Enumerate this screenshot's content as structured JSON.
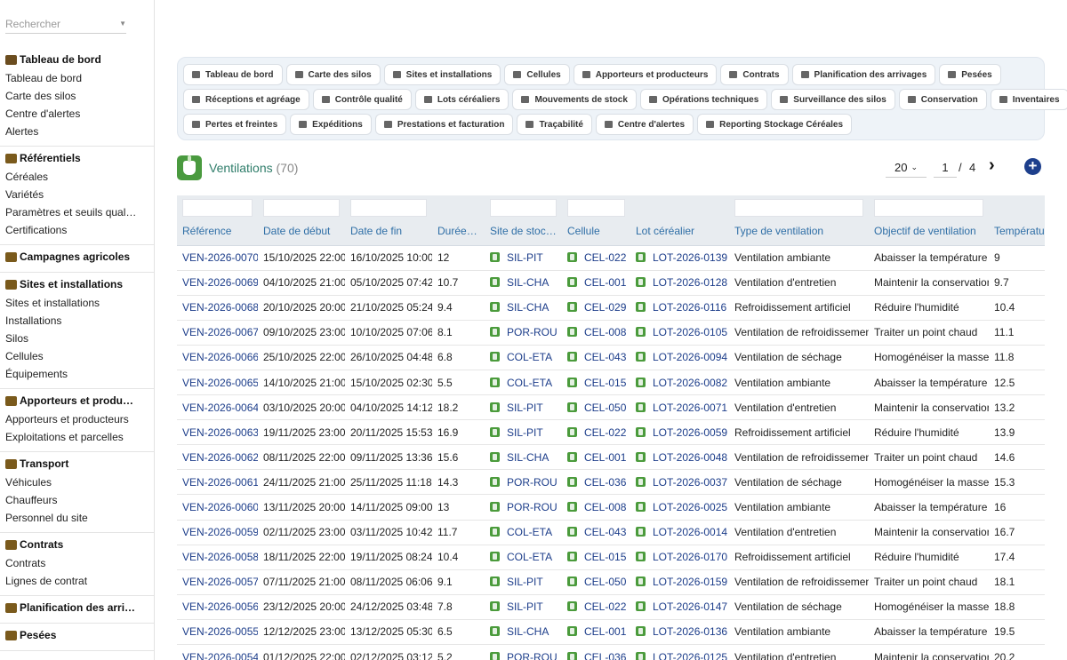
{
  "search": {
    "placeholder": "Rechercher"
  },
  "sidebar": {
    "sections": [
      {
        "title": "Tableau de bord",
        "icon": "dashboard-icon",
        "icon_color": "#6b4d1f",
        "items": [
          "Tableau de bord",
          "Carte des silos",
          "Centre d'alertes",
          "Alertes"
        ]
      },
      {
        "title": "Référentiels",
        "icon": "sprout-icon",
        "icon_color": "#7a5a1c",
        "items": [
          "Céréales",
          "Variétés",
          "Paramètres et seuils qual…",
          "Certifications"
        ]
      },
      {
        "title": "Campagnes agricoles",
        "icon": "calendar-icon",
        "icon_color": "#7a5a1c",
        "items": []
      },
      {
        "title": "Sites et installations",
        "icon": "warehouse-icon",
        "icon_color": "#7a5a1c",
        "items": [
          "Sites et installations",
          "Installations",
          "Silos",
          "Cellules",
          "Équipements"
        ]
      },
      {
        "title": "Apporteurs et produ…",
        "icon": "users-icon",
        "icon_color": "#7a5a1c",
        "items": [
          "Apporteurs et producteurs",
          "Exploitations et parcelles"
        ]
      },
      {
        "title": "Transport",
        "icon": "truck-icon",
        "icon_color": "#7a5a1c",
        "items": [
          "Véhicules",
          "Chauffeurs",
          "Personnel du site"
        ]
      },
      {
        "title": "Contrats",
        "icon": "contract-icon",
        "icon_color": "#7a5a1c",
        "items": [
          "Contrats",
          "Lignes de contrat"
        ]
      },
      {
        "title": "Planification des arri…",
        "icon": "truck-loading-icon",
        "icon_color": "#7a5a1c",
        "items": []
      },
      {
        "title": "Pesées",
        "icon": "scale-icon",
        "icon_color": "#7a5a1c",
        "items": []
      }
    ]
  },
  "menu": {
    "rows": [
      [
        {
          "label": "Tableau de bord",
          "icon": "dashboard-icon"
        },
        {
          "label": "Carte des silos",
          "icon": "grid-icon"
        },
        {
          "label": "Sites et installations",
          "icon": "warehouse-icon"
        },
        {
          "label": "Cellules",
          "icon": "grid-icon"
        },
        {
          "label": "Apporteurs et producteurs",
          "icon": "users-icon"
        },
        {
          "label": "Contrats",
          "icon": "contract-icon"
        },
        {
          "label": "Planification des arrivages",
          "icon": "truck-loading-icon"
        },
        {
          "label": "Pesées",
          "icon": "scale-icon"
        }
      ],
      [
        {
          "label": "Réceptions et agréage",
          "icon": "clipboard-icon"
        },
        {
          "label": "Contrôle qualité",
          "icon": "flask-icon"
        },
        {
          "label": "Lots céréaliers",
          "icon": "box-icon"
        },
        {
          "label": "Mouvements de stock",
          "icon": "exchange-icon"
        },
        {
          "label": "Opérations techniques",
          "icon": "tools-icon"
        },
        {
          "label": "Surveillance des silos",
          "icon": "thermometer-icon"
        },
        {
          "label": "Conservation",
          "icon": "shield-icon"
        },
        {
          "label": "Inventaires",
          "icon": "list-icon"
        }
      ],
      [
        {
          "label": "Pertes et freintes",
          "icon": "arrow-down-icon"
        },
        {
          "label": "Expéditions",
          "icon": "truck-icon"
        },
        {
          "label": "Prestations et facturation",
          "icon": "invoice-icon"
        },
        {
          "label": "Traçabilité",
          "icon": "network-icon"
        },
        {
          "label": "Centre d'alertes",
          "icon": "bell-icon"
        },
        {
          "label": "Reporting Stockage Céréales",
          "icon": "chart-pie-icon"
        }
      ]
    ]
  },
  "page": {
    "title": "Ventilations",
    "count": "(70)",
    "per_page": "20",
    "current_page": "1",
    "separator": "/",
    "total_pages": "4",
    "next_icon": "chevron-right-icon",
    "add_icon": "plus-circle-icon",
    "accent_color": "#2f7d6a",
    "link_color": "#1c3d8a",
    "tag_color": "#4b9b3c"
  },
  "table": {
    "columns": [
      "Référence",
      "Date de début",
      "Date de fin",
      "Durée (h)",
      "Site de stock…",
      "Cellule",
      "Lot céréalier",
      "Type de ventilation",
      "Objectif de ventilation",
      "Température"
    ],
    "filter_columns": [
      0,
      1,
      2,
      4,
      5,
      7,
      8
    ],
    "rows": [
      [
        "VEN-2026-0070",
        "15/10/2025 22:00",
        "16/10/2025 10:00",
        "12",
        "SIL-PIT",
        "CEL-022",
        "LOT-2026-0139",
        "Ventilation ambiante",
        "Abaisser la température",
        "9"
      ],
      [
        "VEN-2026-0069",
        "04/10/2025 21:00",
        "05/10/2025 07:42",
        "10.7",
        "SIL-CHA",
        "CEL-001",
        "LOT-2026-0128",
        "Ventilation d'entretien",
        "Maintenir la conservation",
        "9.7"
      ],
      [
        "VEN-2026-0068",
        "20/10/2025 20:00",
        "21/10/2025 05:24",
        "9.4",
        "SIL-CHA",
        "CEL-029",
        "LOT-2026-0116",
        "Refroidissement artificiel",
        "Réduire l'humidité",
        "10.4"
      ],
      [
        "VEN-2026-0067",
        "09/10/2025 23:00",
        "10/10/2025 07:06",
        "8.1",
        "POR-ROU",
        "CEL-008",
        "LOT-2026-0105",
        "Ventilation de refroidissement",
        "Traiter un point chaud",
        "11.1"
      ],
      [
        "VEN-2026-0066",
        "25/10/2025 22:00",
        "26/10/2025 04:48",
        "6.8",
        "COL-ETA",
        "CEL-043",
        "LOT-2026-0094",
        "Ventilation de séchage",
        "Homogénéiser la masse",
        "11.8"
      ],
      [
        "VEN-2026-0065",
        "14/10/2025 21:00",
        "15/10/2025 02:30",
        "5.5",
        "COL-ETA",
        "CEL-015",
        "LOT-2026-0082",
        "Ventilation ambiante",
        "Abaisser la température",
        "12.5"
      ],
      [
        "VEN-2026-0064",
        "03/10/2025 20:00",
        "04/10/2025 14:12",
        "18.2",
        "SIL-PIT",
        "CEL-050",
        "LOT-2026-0071",
        "Ventilation d'entretien",
        "Maintenir la conservation",
        "13.2"
      ],
      [
        "VEN-2026-0063",
        "19/11/2025 23:00",
        "20/11/2025 15:53",
        "16.9",
        "SIL-PIT",
        "CEL-022",
        "LOT-2026-0059",
        "Refroidissement artificiel",
        "Réduire l'humidité",
        "13.9"
      ],
      [
        "VEN-2026-0062",
        "08/11/2025 22:00",
        "09/11/2025 13:36",
        "15.6",
        "SIL-CHA",
        "CEL-001",
        "LOT-2026-0048",
        "Ventilation de refroidissement",
        "Traiter un point chaud",
        "14.6"
      ],
      [
        "VEN-2026-0061",
        "24/11/2025 21:00",
        "25/11/2025 11:18",
        "14.3",
        "POR-ROU",
        "CEL-036",
        "LOT-2026-0037",
        "Ventilation de séchage",
        "Homogénéiser la masse",
        "15.3"
      ],
      [
        "VEN-2026-0060",
        "13/11/2025 20:00",
        "14/11/2025 09:00",
        "13",
        "POR-ROU",
        "CEL-008",
        "LOT-2026-0025",
        "Ventilation ambiante",
        "Abaisser la température",
        "16"
      ],
      [
        "VEN-2026-0059",
        "02/11/2025 23:00",
        "03/11/2025 10:42",
        "11.7",
        "COL-ETA",
        "CEL-043",
        "LOT-2026-0014",
        "Ventilation d'entretien",
        "Maintenir la conservation",
        "16.7"
      ],
      [
        "VEN-2026-0058",
        "18/11/2025 22:00",
        "19/11/2025 08:24",
        "10.4",
        "COL-ETA",
        "CEL-015",
        "LOT-2026-0170",
        "Refroidissement artificiel",
        "Réduire l'humidité",
        "17.4"
      ],
      [
        "VEN-2026-0057",
        "07/11/2025 21:00",
        "08/11/2025 06:06",
        "9.1",
        "SIL-PIT",
        "CEL-050",
        "LOT-2026-0159",
        "Ventilation de refroidissement",
        "Traiter un point chaud",
        "18.1"
      ],
      [
        "VEN-2026-0056",
        "23/12/2025 20:00",
        "24/12/2025 03:48",
        "7.8",
        "SIL-PIT",
        "CEL-022",
        "LOT-2026-0147",
        "Ventilation de séchage",
        "Homogénéiser la masse",
        "18.8"
      ],
      [
        "VEN-2026-0055",
        "12/12/2025 23:00",
        "13/12/2025 05:30",
        "6.5",
        "SIL-CHA",
        "CEL-001",
        "LOT-2026-0136",
        "Ventilation ambiante",
        "Abaisser la température",
        "19.5"
      ],
      [
        "VEN-2026-0054",
        "01/12/2025 22:00",
        "02/12/2025 03:12",
        "5.2",
        "POR-ROU",
        "CEL-036",
        "LOT-2026-0125",
        "Ventilation d'entretien",
        "Maintenir la conservation",
        "20.2"
      ]
    ]
  }
}
